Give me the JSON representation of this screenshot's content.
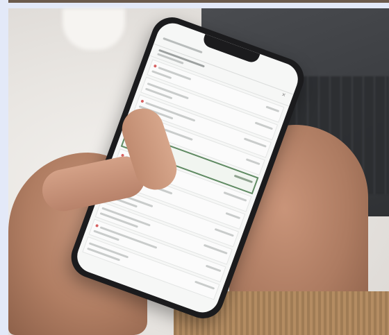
{
  "scene": {
    "description_elements": [
      "photo-background",
      "laptop",
      "left-hand",
      "right-hand",
      "smartphone"
    ],
    "colors": {
      "frame": "#e3e9f8",
      "highlight_border": "#5f8a62",
      "alert_dot": "#d66060"
    }
  },
  "phone_screen": {
    "entries": [
      {
        "has_alert": true
      },
      {
        "has_alert": false
      },
      {
        "has_alert": true
      },
      {
        "has_alert": false
      },
      {
        "has_alert": false,
        "selected": true
      },
      {
        "has_alert": true
      },
      {
        "has_alert": false
      },
      {
        "has_alert": true
      },
      {
        "has_alert": false
      },
      {
        "has_alert": true
      },
      {
        "has_alert": false
      }
    ]
  }
}
